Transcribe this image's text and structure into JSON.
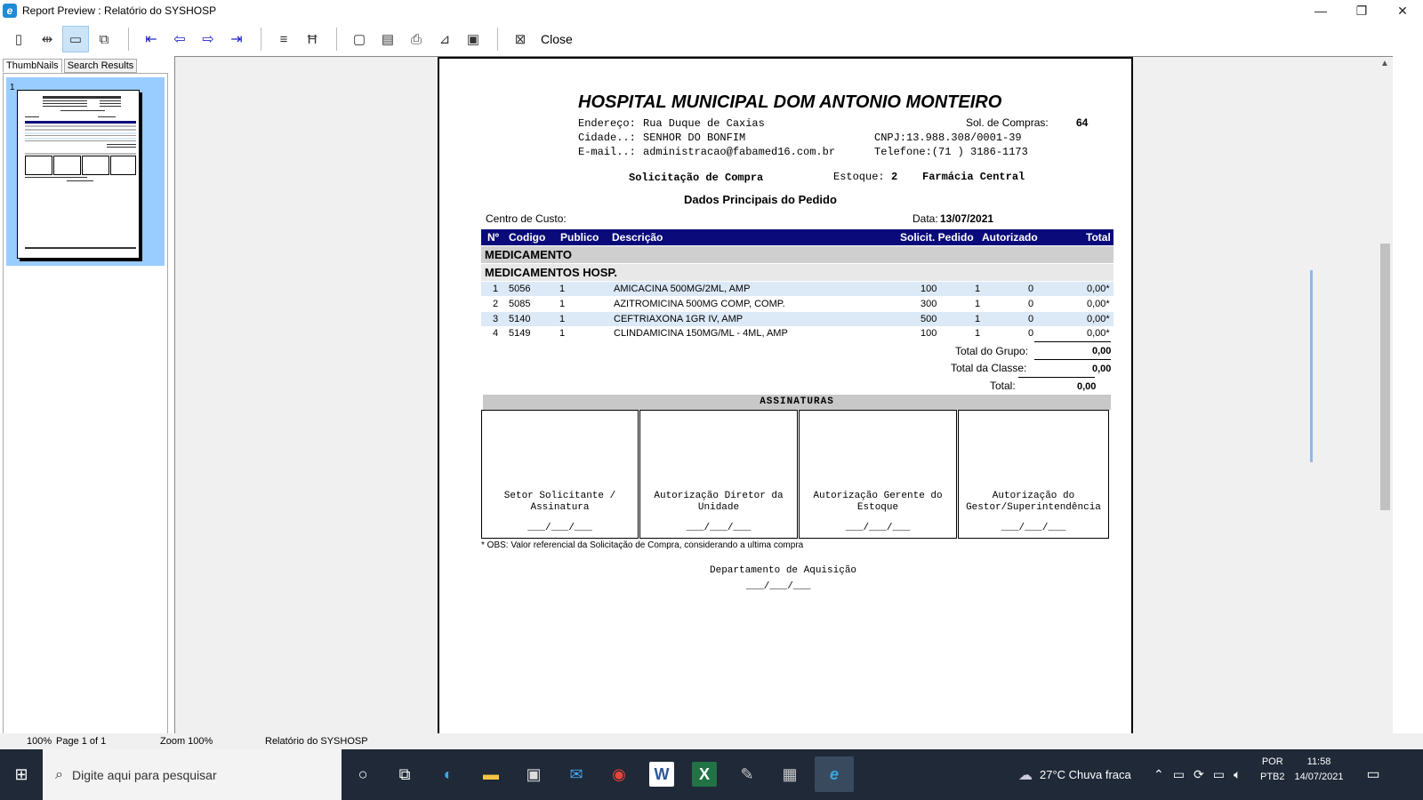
{
  "window": {
    "title": "Report Preview : Relatório do SYSHOSP",
    "minimize": "—",
    "restore": "❐",
    "close": "✕"
  },
  "toolbar": {
    "close_label": "Close"
  },
  "left_tabs": [
    "ThumbNails",
    "Search Results"
  ],
  "thumbnail": {
    "number": "1"
  },
  "report": {
    "hospital": "HOSPITAL MUNICIPAL DOM ANTONIO MONTEIRO",
    "endereco_label": "Endereço:",
    "endereco": "Rua Duque de Caxias",
    "cidade_label": "Cidade..:",
    "cidade": "SENHOR DO BONFIM",
    "email_label": "E-mail..:",
    "email": "administracao@fabamed16.com.br",
    "sol_compras_label": "Sol. de Compras:",
    "sol_compras": "64",
    "cnpj": "CNPJ:13.988.308/0001-39",
    "telefone": "Telefone:(71 ) 3186-1173",
    "doc_type": "Solicitação de Compra",
    "estoque_label": "Estoque:",
    "estoque": "2",
    "farmacia": "Farmácia Central",
    "section_title": "Dados Principais do Pedido",
    "centro_custo_label": "Centro de Custo:",
    "data_label": "Data:",
    "data": "13/07/2021",
    "columns": {
      "n": "Nº",
      "codigo": "Codigo",
      "publico": "Publico",
      "descricao": "Descrição",
      "solicit": "Solicit. Pedido",
      "autorizado": "Autorizado",
      "total": "Total"
    },
    "group1": "MEDICAMENTO",
    "group2": "MEDICAMENTOS HOSP.",
    "rows": [
      {
        "n": "1",
        "codigo": "5056",
        "publico": "1",
        "descricao": "AMICACINA 500MG/2ML, AMP",
        "solicit": "100",
        "pedido": "1",
        "autorizado": "0",
        "total": "0,00*"
      },
      {
        "n": "2",
        "codigo": "5085",
        "publico": "1",
        "descricao": "AZITROMICINA 500MG COMP, COMP.",
        "solicit": "300",
        "pedido": "1",
        "autorizado": "0",
        "total": "0,00*"
      },
      {
        "n": "3",
        "codigo": "5140",
        "publico": "1",
        "descricao": "CEFTRIAXONA 1GR IV, AMP",
        "solicit": "500",
        "pedido": "1",
        "autorizado": "0",
        "total": "0,00*"
      },
      {
        "n": "4",
        "codigo": "5149",
        "publico": "1",
        "descricao": "CLINDAMICINA 150MG/ML - 4ML, AMP",
        "solicit": "100",
        "pedido": "1",
        "autorizado": "0",
        "total": "0,00*"
      }
    ],
    "total_grupo_label": "Total do Grupo:",
    "total_grupo": "0,00",
    "total_classe_label": "Total da Classe:",
    "total_classe": "0,00",
    "total_label": "Total:",
    "total": "0,00",
    "assinaturas": "ASSINATURAS",
    "sig_labels": [
      "Setor Solicitante / Assinatura",
      "Autorização Diretor da Unidade",
      "Autorização Gerente do Estoque",
      "Autorização do Gestor/Superintendência"
    ],
    "date_placeholder": "___/___/___",
    "obs": "* OBS: Valor referencial da Solicitação de Compra, considerando a ultima compra",
    "departamento": "Departamento de Aquisição"
  },
  "status": {
    "zoom_pct": "100%",
    "page": "Page 1 of 1",
    "zoom": "Zoom 100%",
    "report_name": "Relatório do SYSHOSP"
  },
  "taskbar": {
    "search_placeholder": "Digite aqui para pesquisar",
    "weather": "27°C  Chuva fraca",
    "lang1": "POR",
    "lang2": "PTB2",
    "time": "11:58",
    "date": "14/07/2021"
  }
}
